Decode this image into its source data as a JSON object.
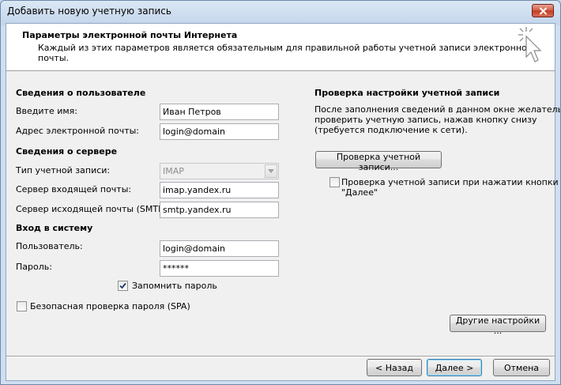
{
  "window": {
    "title": "Добавить новую учетную запись"
  },
  "header": {
    "title": "Параметры электронной почты Интернета",
    "description": "Каждый из этих параметров является обязательным для правильной работы учетной записи электронной почты."
  },
  "user_info": {
    "section_label": "Сведения о пользователе",
    "name_label": "Введите имя:",
    "name_value": "Иван Петров",
    "email_label": "Адрес электронной почты:",
    "email_value": "login@domain"
  },
  "server_info": {
    "section_label": "Сведения о сервере",
    "account_type_label": "Тип учетной записи:",
    "account_type_value": "IMAP",
    "incoming_label": "Сервер входящей почты:",
    "incoming_value": "imap.yandex.ru",
    "outgoing_label": "Сервер исходящей почты (SMTP):",
    "outgoing_value": "smtp.yandex.ru"
  },
  "logon": {
    "section_label": "Вход в систему",
    "user_label": "Пользователь:",
    "user_value": "login@domain",
    "password_label": "Пароль:",
    "password_value": "******",
    "remember_label": "Запомнить пароль",
    "remember_checked": true,
    "spa_label": "Безопасная проверка пароля (SPA)",
    "spa_checked": false
  },
  "test_settings": {
    "section_label": "Проверка настройки учетной записи",
    "description_line1": "После заполнения сведений в данном окне желательно",
    "description_line2": "проверить учетную запись, нажав кнопку снизу",
    "description_line3": "(требуется подключение к сети).",
    "test_button": "Проверка учетной записи...",
    "auto_test_line1": "Проверка учетной записи при нажатии кнопки",
    "auto_test_line2": "\"Далее\"",
    "auto_test_checked": false
  },
  "buttons": {
    "more_settings": "Другие настройки ...",
    "back": "< Назад",
    "next": "Далее >",
    "cancel": "Отмена"
  },
  "colors": {
    "window_frame": "#c4d6ec",
    "dialog_bg": "#f0f0f0",
    "header_bg": "#ffffff",
    "close_button": "#c13a20"
  }
}
